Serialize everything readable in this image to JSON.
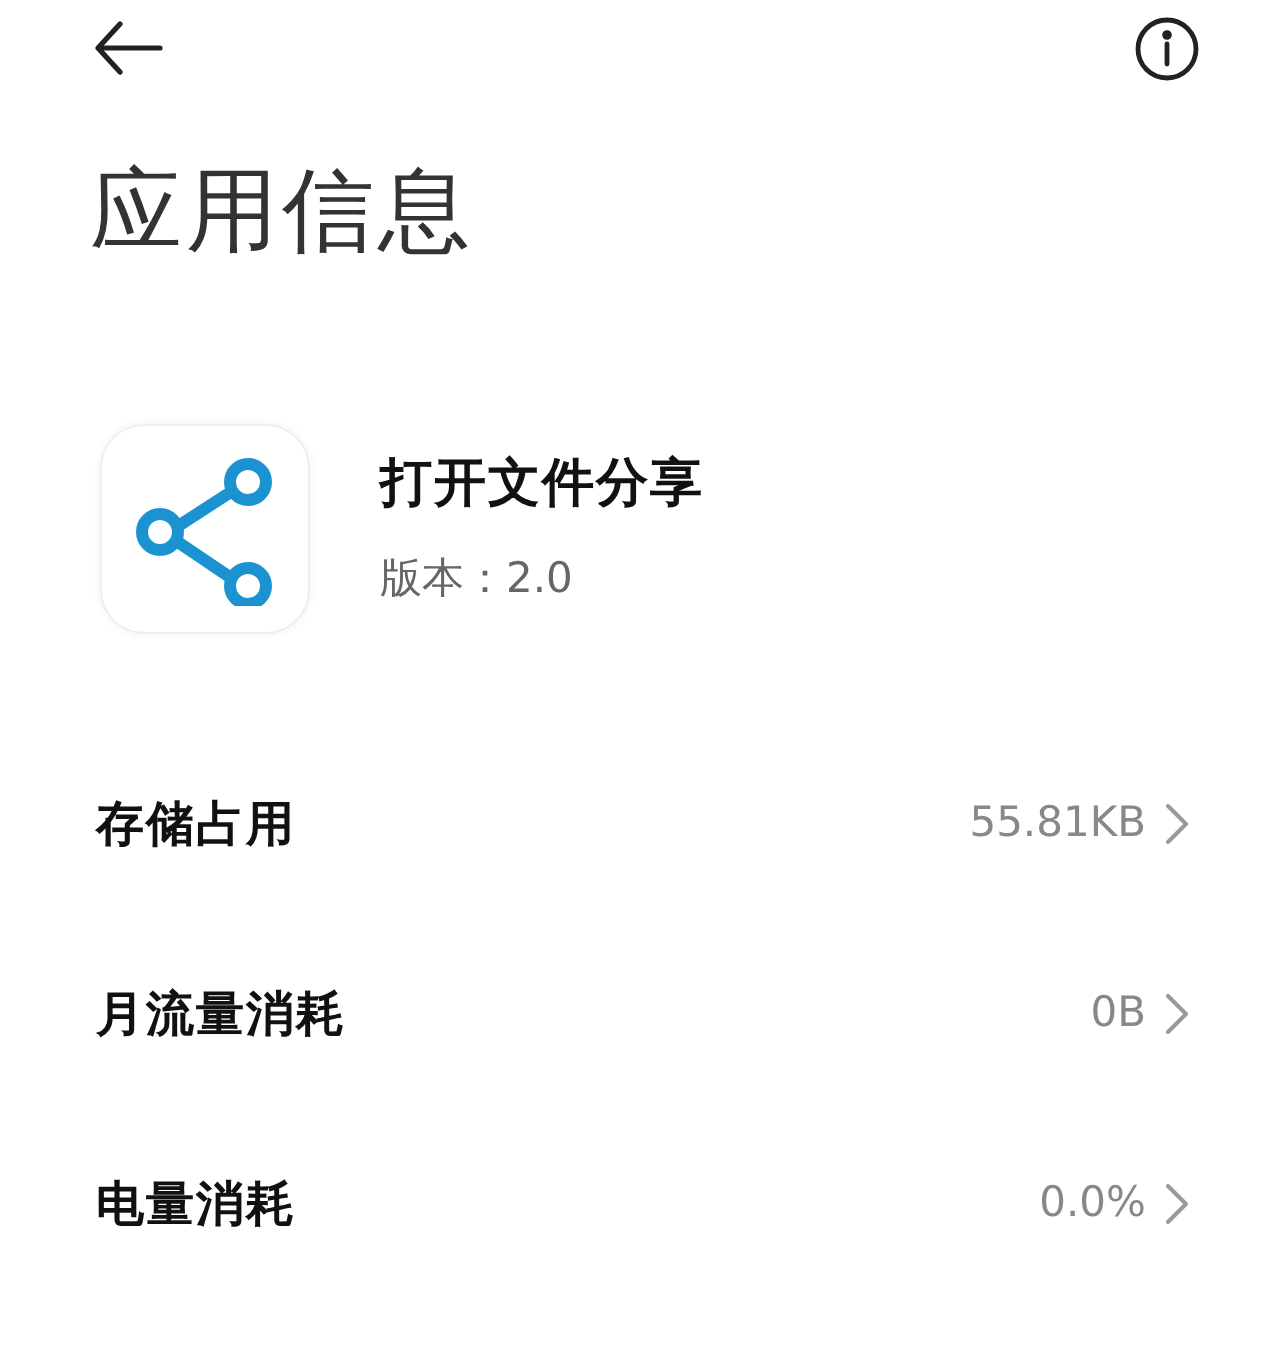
{
  "header": {
    "title": "应用信息"
  },
  "app": {
    "name": "打开文件分享",
    "version": "版本：2.0"
  },
  "rows": [
    {
      "label": "存储占用",
      "value": "55.81KB"
    },
    {
      "label": "月流量消耗",
      "value": "0B"
    },
    {
      "label": "电量消耗",
      "value": "0.0%"
    }
  ]
}
